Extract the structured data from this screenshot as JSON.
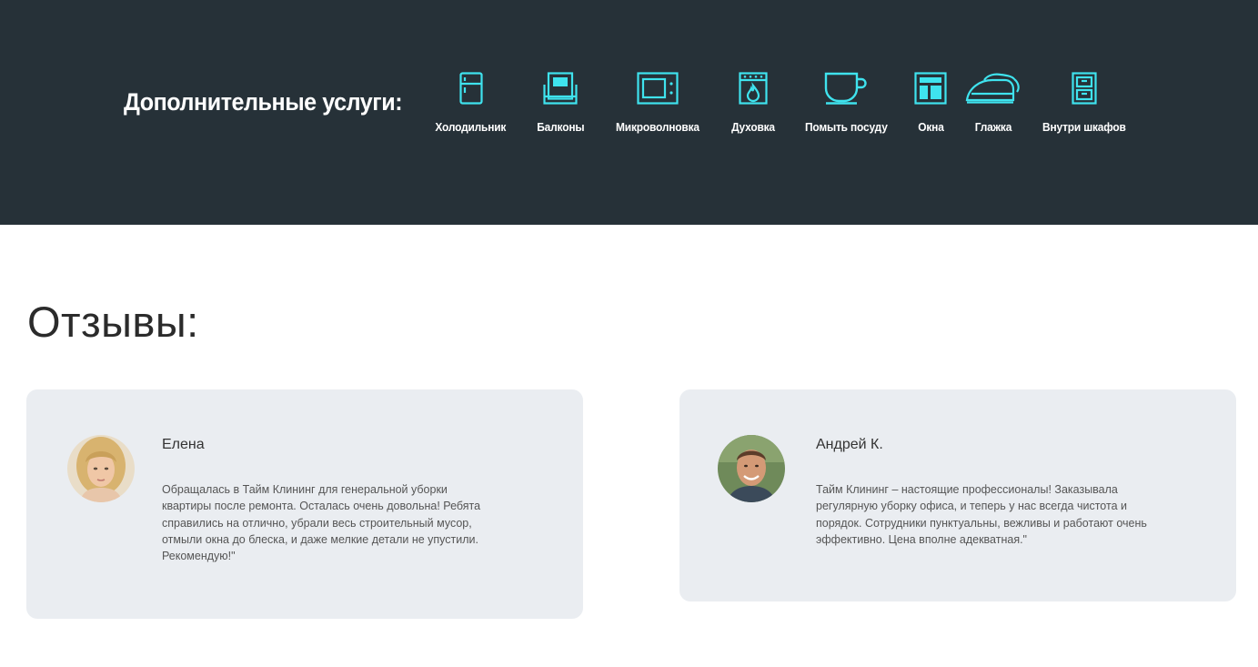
{
  "services": {
    "title": "Дополнительные услуги:",
    "accent_color": "#3fe3ee",
    "items": [
      {
        "label": "Холодильник",
        "icon": "fridge-icon"
      },
      {
        "label": "Балконы",
        "icon": "balcony-icon"
      },
      {
        "label": "Микроволновка",
        "icon": "microwave-icon"
      },
      {
        "label": "Духовка",
        "icon": "oven-icon"
      },
      {
        "label": "Помыть посуду",
        "icon": "cup-icon"
      },
      {
        "label": "Окна",
        "icon": "window-icon"
      },
      {
        "label": "Глажка",
        "icon": "iron-icon"
      },
      {
        "label": "Внутри шкафов",
        "icon": "cabinet-icon"
      }
    ]
  },
  "reviews": {
    "title": "Отзывы:",
    "items": [
      {
        "name": "Елена",
        "text": "Обращалась в Тайм Клининг для генеральной уборки квартиры после ремонта. Осталась очень довольна! Ребята справились на отлично, убрали весь строительный мусор, отмыли окна до блеска, и даже мелкие детали не упустили. Рекомендую!\""
      },
      {
        "name": "Андрей К.",
        "text": "Тайм Клининг – настоящие профессионалы! Заказывала регулярную уборку офиса, и теперь у нас всегда чистота и порядок. Сотрудники пунктуальны, вежливы и работают очень эффективно. Цена вполне адекватная.\""
      }
    ]
  }
}
